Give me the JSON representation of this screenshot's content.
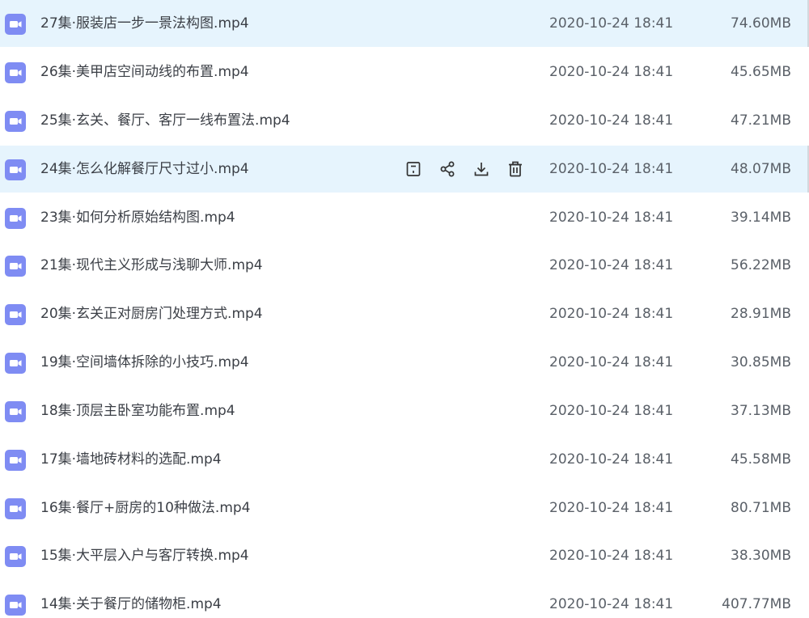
{
  "files": [
    {
      "name": "27集·服装店一步一景法构图.mp4",
      "date": "2020-10-24 18:41",
      "size": "74.60MB"
    },
    {
      "name": "26集·美甲店空间动线的布置.mp4",
      "date": "2020-10-24 18:41",
      "size": "45.65MB"
    },
    {
      "name": "25集·玄关、餐厅、客厅一线布置法.mp4",
      "date": "2020-10-24 18:41",
      "size": "47.21MB"
    },
    {
      "name": "24集·怎么化解餐厅尺寸过小.mp4",
      "date": "2020-10-24 18:41",
      "size": "48.07MB"
    },
    {
      "name": "23集·如何分析原始结构图.mp4",
      "date": "2020-10-24 18:41",
      "size": "39.14MB"
    },
    {
      "name": "21集·现代主义形成与浅聊大师.mp4",
      "date": "2020-10-24 18:41",
      "size": "56.22MB"
    },
    {
      "name": "20集·玄关正对厨房门处理方式.mp4",
      "date": "2020-10-24 18:41",
      "size": "28.91MB"
    },
    {
      "name": "19集·空间墙体拆除的小技巧.mp4",
      "date": "2020-10-24 18:41",
      "size": "30.85MB"
    },
    {
      "name": "18集·顶层主卧室功能布置.mp4",
      "date": "2020-10-24 18:41",
      "size": "37.13MB"
    },
    {
      "name": "17集·墙地砖材料的选配.mp4",
      "date": "2020-10-24 18:41",
      "size": "45.58MB"
    },
    {
      "name": "16集·餐厅+厨房的10种做法.mp4",
      "date": "2020-10-24 18:41",
      "size": "80.71MB"
    },
    {
      "name": "15集·大平层入户与客厅转换.mp4",
      "date": "2020-10-24 18:41",
      "size": "38.30MB"
    },
    {
      "name": "14集·关于餐厅的储物柜.mp4",
      "date": "2020-10-24 18:41",
      "size": "407.77MB"
    }
  ],
  "highlighted_rows": [
    0,
    3
  ],
  "hover_row": 3,
  "icons": {
    "file": "video-file-icon",
    "actions": [
      "save-icon",
      "share-icon",
      "download-icon",
      "delete-icon"
    ]
  },
  "colors": {
    "row_highlight": "#e6f4fd",
    "file_icon": "#7f8cf3",
    "action_icon": "#333333"
  }
}
